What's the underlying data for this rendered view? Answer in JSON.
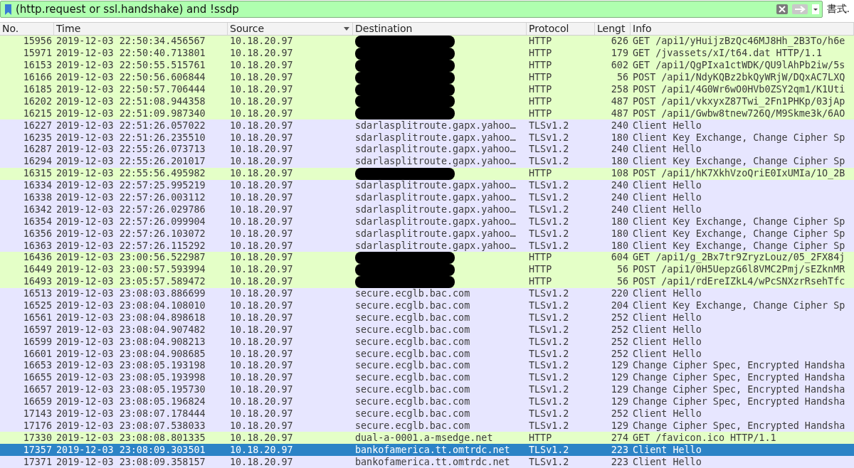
{
  "filter_bar": {
    "value": "(http.request or ssl.handshake) and !ssdp",
    "valid": true,
    "format_label": "書式."
  },
  "columns": [
    {
      "label": "No.",
      "sorted": false
    },
    {
      "label": "Time",
      "sorted": false
    },
    {
      "label": "Source",
      "sorted": true
    },
    {
      "label": "Destination",
      "sorted": false
    },
    {
      "label": "Protocol",
      "sorted": false
    },
    {
      "label": "Lengt",
      "sorted": false
    },
    {
      "label": "Info",
      "sorted": false
    }
  ],
  "rows": [
    {
      "no": "15956",
      "time": "2019-12-03 22:50:34.456567",
      "source": "10.18.20.97",
      "redacted": true,
      "protocol": "HTTP",
      "length": "626",
      "info": "GET /api1/yHuijzBzQc46MJ8Hh_2B3To/h6e",
      "color": "#e4ffc7",
      "selected": false
    },
    {
      "no": "15971",
      "time": "2019-12-03 22:50:40.713801",
      "source": "10.18.20.97",
      "redacted": true,
      "protocol": "HTTP",
      "length": "179",
      "info": "GET /jvassets/xI/t64.dat HTTP/1.1",
      "color": "#e4ffc7",
      "selected": false
    },
    {
      "no": "16153",
      "time": "2019-12-03 22:50:55.515761",
      "source": "10.18.20.97",
      "redacted": true,
      "protocol": "HTTP",
      "length": "602",
      "info": "GET /api1/QgPIxa1ctWDK/QU9lAhPb2iw/5s",
      "color": "#e4ffc7",
      "selected": false
    },
    {
      "no": "16166",
      "time": "2019-12-03 22:50:56.606844",
      "source": "10.18.20.97",
      "redacted": true,
      "protocol": "HTTP",
      "length": "56",
      "info": "POST /api1/NdyKQBz2bkQyWRjW/DQxAC7LXQ",
      "color": "#e4ffc7",
      "selected": false
    },
    {
      "no": "16185",
      "time": "2019-12-03 22:50:57.706444",
      "source": "10.18.20.97",
      "redacted": true,
      "protocol": "HTTP",
      "length": "258",
      "info": "POST /api1/4G0Wr6wO0HVb0ZSY2qm1/K1Uti",
      "color": "#e4ffc7",
      "selected": false
    },
    {
      "no": "16202",
      "time": "2019-12-03 22:51:08.944358",
      "source": "10.18.20.97",
      "redacted": true,
      "protocol": "HTTP",
      "length": "487",
      "info": "POST /api1/vkxyxZ87Twi_2Fn1PHKp/03jAp",
      "color": "#e4ffc7",
      "selected": false
    },
    {
      "no": "16215",
      "time": "2019-12-03 22:51:09.987340",
      "source": "10.18.20.97",
      "redacted": true,
      "protocol": "HTTP",
      "length": "487",
      "info": "POST /api1/Gwbw8tnew726Q/M9Skme3k/6AO",
      "color": "#e4ffc7",
      "selected": false
    },
    {
      "no": "16227",
      "time": "2019-12-03 22:51:26.057022",
      "source": "10.18.20.97",
      "destination": "sdarlasplitroute.gapx.yahoo…",
      "protocol": "TLSv1.2",
      "length": "240",
      "info": "Client Hello",
      "color": "#e7e6ff",
      "selected": false
    },
    {
      "no": "16235",
      "time": "2019-12-03 22:51:26.235510",
      "source": "10.18.20.97",
      "destination": "sdarlasplitroute.gapx.yahoo…",
      "protocol": "TLSv1.2",
      "length": "180",
      "info": "Client Key Exchange, Change Cipher Sp",
      "color": "#e7e6ff",
      "selected": false
    },
    {
      "no": "16287",
      "time": "2019-12-03 22:55:26.073713",
      "source": "10.18.20.97",
      "destination": "sdarlasplitroute.gapx.yahoo…",
      "protocol": "TLSv1.2",
      "length": "240",
      "info": "Client Hello",
      "color": "#e7e6ff",
      "selected": false
    },
    {
      "no": "16294",
      "time": "2019-12-03 22:55:26.201017",
      "source": "10.18.20.97",
      "destination": "sdarlasplitroute.gapx.yahoo…",
      "protocol": "TLSv1.2",
      "length": "180",
      "info": "Client Key Exchange, Change Cipher Sp",
      "color": "#e7e6ff",
      "selected": false
    },
    {
      "no": "16315",
      "time": "2019-12-03 22:55:56.495982",
      "source": "10.18.20.97",
      "redacted": true,
      "protocol": "HTTP",
      "length": "108",
      "info": "POST /api1/hK7XkhVzoQriE0IxUMIa/1O_2B",
      "color": "#e4ffc7",
      "selected": false
    },
    {
      "no": "16334",
      "time": "2019-12-03 22:57:25.995219",
      "source": "10.18.20.97",
      "destination": "sdarlasplitroute.gapx.yahoo…",
      "protocol": "TLSv1.2",
      "length": "240",
      "info": "Client Hello",
      "color": "#e7e6ff",
      "selected": false
    },
    {
      "no": "16338",
      "time": "2019-12-03 22:57:26.003112",
      "source": "10.18.20.97",
      "destination": "sdarlasplitroute.gapx.yahoo…",
      "protocol": "TLSv1.2",
      "length": "240",
      "info": "Client Hello",
      "color": "#e7e6ff",
      "selected": false
    },
    {
      "no": "16342",
      "time": "2019-12-03 22:57:26.029786",
      "source": "10.18.20.97",
      "destination": "sdarlasplitroute.gapx.yahoo…",
      "protocol": "TLSv1.2",
      "length": "240",
      "info": "Client Hello",
      "color": "#e7e6ff",
      "selected": false
    },
    {
      "no": "16354",
      "time": "2019-12-03 22:57:26.099904",
      "source": "10.18.20.97",
      "destination": "sdarlasplitroute.gapx.yahoo…",
      "protocol": "TLSv1.2",
      "length": "180",
      "info": "Client Key Exchange, Change Cipher Sp",
      "color": "#e7e6ff",
      "selected": false
    },
    {
      "no": "16356",
      "time": "2019-12-03 22:57:26.103072",
      "source": "10.18.20.97",
      "destination": "sdarlasplitroute.gapx.yahoo…",
      "protocol": "TLSv1.2",
      "length": "180",
      "info": "Client Key Exchange, Change Cipher Sp",
      "color": "#e7e6ff",
      "selected": false
    },
    {
      "no": "16363",
      "time": "2019-12-03 22:57:26.115292",
      "source": "10.18.20.97",
      "destination": "sdarlasplitroute.gapx.yahoo…",
      "protocol": "TLSv1.2",
      "length": "180",
      "info": "Client Key Exchange, Change Cipher Sp",
      "color": "#e7e6ff",
      "selected": false
    },
    {
      "no": "16436",
      "time": "2019-12-03 23:00:56.522987",
      "source": "10.18.20.97",
      "redacted": true,
      "protocol": "HTTP",
      "length": "604",
      "info": "GET /api1/g_2Bx7tr9ZryzLouz/05_2FX84j",
      "color": "#e4ffc7",
      "selected": false
    },
    {
      "no": "16449",
      "time": "2019-12-03 23:00:57.593994",
      "source": "10.18.20.97",
      "redacted": true,
      "protocol": "HTTP",
      "length": "56",
      "info": "POST /api1/0H5UepzG6l8VMC2Pmj/sEZknMR",
      "color": "#e4ffc7",
      "selected": false
    },
    {
      "no": "16493",
      "time": "2019-12-03 23:05:57.589472",
      "source": "10.18.20.97",
      "redacted": true,
      "protocol": "HTTP",
      "length": "56",
      "info": "POST /api1/rdEreIZkL4/wPcSNXzrRsehTfc",
      "color": "#e4ffc7",
      "selected": false
    },
    {
      "no": "16513",
      "time": "2019-12-03 23:08:03.886699",
      "source": "10.18.20.97",
      "destination": "secure.ecglb.bac.com",
      "protocol": "TLSv1.2",
      "length": "220",
      "info": "Client Hello",
      "color": "#e7e6ff",
      "selected": false
    },
    {
      "no": "16525",
      "time": "2019-12-03 23:08:04.108010",
      "source": "10.18.20.97",
      "destination": "secure.ecglb.bac.com",
      "protocol": "TLSv1.2",
      "length": "204",
      "info": "Client Key Exchange, Change Cipher Sp",
      "color": "#e7e6ff",
      "selected": false
    },
    {
      "no": "16561",
      "time": "2019-12-03 23:08:04.898618",
      "source": "10.18.20.97",
      "destination": "secure.ecglb.bac.com",
      "protocol": "TLSv1.2",
      "length": "252",
      "info": "Client Hello",
      "color": "#e7e6ff",
      "selected": false
    },
    {
      "no": "16597",
      "time": "2019-12-03 23:08:04.907482",
      "source": "10.18.20.97",
      "destination": "secure.ecglb.bac.com",
      "protocol": "TLSv1.2",
      "length": "252",
      "info": "Client Hello",
      "color": "#e7e6ff",
      "selected": false
    },
    {
      "no": "16599",
      "time": "2019-12-03 23:08:04.908213",
      "source": "10.18.20.97",
      "destination": "secure.ecglb.bac.com",
      "protocol": "TLSv1.2",
      "length": "252",
      "info": "Client Hello",
      "color": "#e7e6ff",
      "selected": false
    },
    {
      "no": "16601",
      "time": "2019-12-03 23:08:04.908685",
      "source": "10.18.20.97",
      "destination": "secure.ecglb.bac.com",
      "protocol": "TLSv1.2",
      "length": "252",
      "info": "Client Hello",
      "color": "#e7e6ff",
      "selected": false
    },
    {
      "no": "16653",
      "time": "2019-12-03 23:08:05.193198",
      "source": "10.18.20.97",
      "destination": "secure.ecglb.bac.com",
      "protocol": "TLSv1.2",
      "length": "129",
      "info": "Change Cipher Spec, Encrypted Handsha",
      "color": "#e7e6ff",
      "selected": false
    },
    {
      "no": "16655",
      "time": "2019-12-03 23:08:05.193998",
      "source": "10.18.20.97",
      "destination": "secure.ecglb.bac.com",
      "protocol": "TLSv1.2",
      "length": "129",
      "info": "Change Cipher Spec, Encrypted Handsha",
      "color": "#e7e6ff",
      "selected": false
    },
    {
      "no": "16657",
      "time": "2019-12-03 23:08:05.195730",
      "source": "10.18.20.97",
      "destination": "secure.ecglb.bac.com",
      "protocol": "TLSv1.2",
      "length": "129",
      "info": "Change Cipher Spec, Encrypted Handsha",
      "color": "#e7e6ff",
      "selected": false
    },
    {
      "no": "16659",
      "time": "2019-12-03 23:08:05.196824",
      "source": "10.18.20.97",
      "destination": "secure.ecglb.bac.com",
      "protocol": "TLSv1.2",
      "length": "129",
      "info": "Change Cipher Spec, Encrypted Handsha",
      "color": "#e7e6ff",
      "selected": false
    },
    {
      "no": "17143",
      "time": "2019-12-03 23:08:07.178444",
      "source": "10.18.20.97",
      "destination": "secure.ecglb.bac.com",
      "protocol": "TLSv1.2",
      "length": "252",
      "info": "Client Hello",
      "color": "#e7e6ff",
      "selected": false
    },
    {
      "no": "17176",
      "time": "2019-12-03 23:08:07.538033",
      "source": "10.18.20.97",
      "destination": "secure.ecglb.bac.com",
      "protocol": "TLSv1.2",
      "length": "129",
      "info": "Change Cipher Spec, Encrypted Handsha",
      "color": "#e7e6ff",
      "selected": false
    },
    {
      "no": "17330",
      "time": "2019-12-03 23:08:08.801335",
      "source": "10.18.20.97",
      "destination": "dual-a-0001.a-msedge.net",
      "protocol": "HTTP",
      "length": "274",
      "info": "GET /favicon.ico HTTP/1.1",
      "color": "#e4ffc7",
      "selected": false
    },
    {
      "no": "17357",
      "time": "2019-12-03 23:08:09.303501",
      "source": "10.18.20.97",
      "destination": "bankofamerica.tt.omtrdc.net",
      "protocol": "TLSv1.2",
      "length": "223",
      "info": "Client Hello",
      "color": "#e7e6ff",
      "selected": true
    },
    {
      "no": "17371",
      "time": "2019-12-03 23:08:09.358157",
      "source": "10.18.20.97",
      "destination": "bankofamerica.tt.omtrdc.net",
      "protocol": "TLSv1.2",
      "length": "223",
      "info": "Client Hello",
      "color": "#e7e6ff",
      "selected": false
    }
  ]
}
